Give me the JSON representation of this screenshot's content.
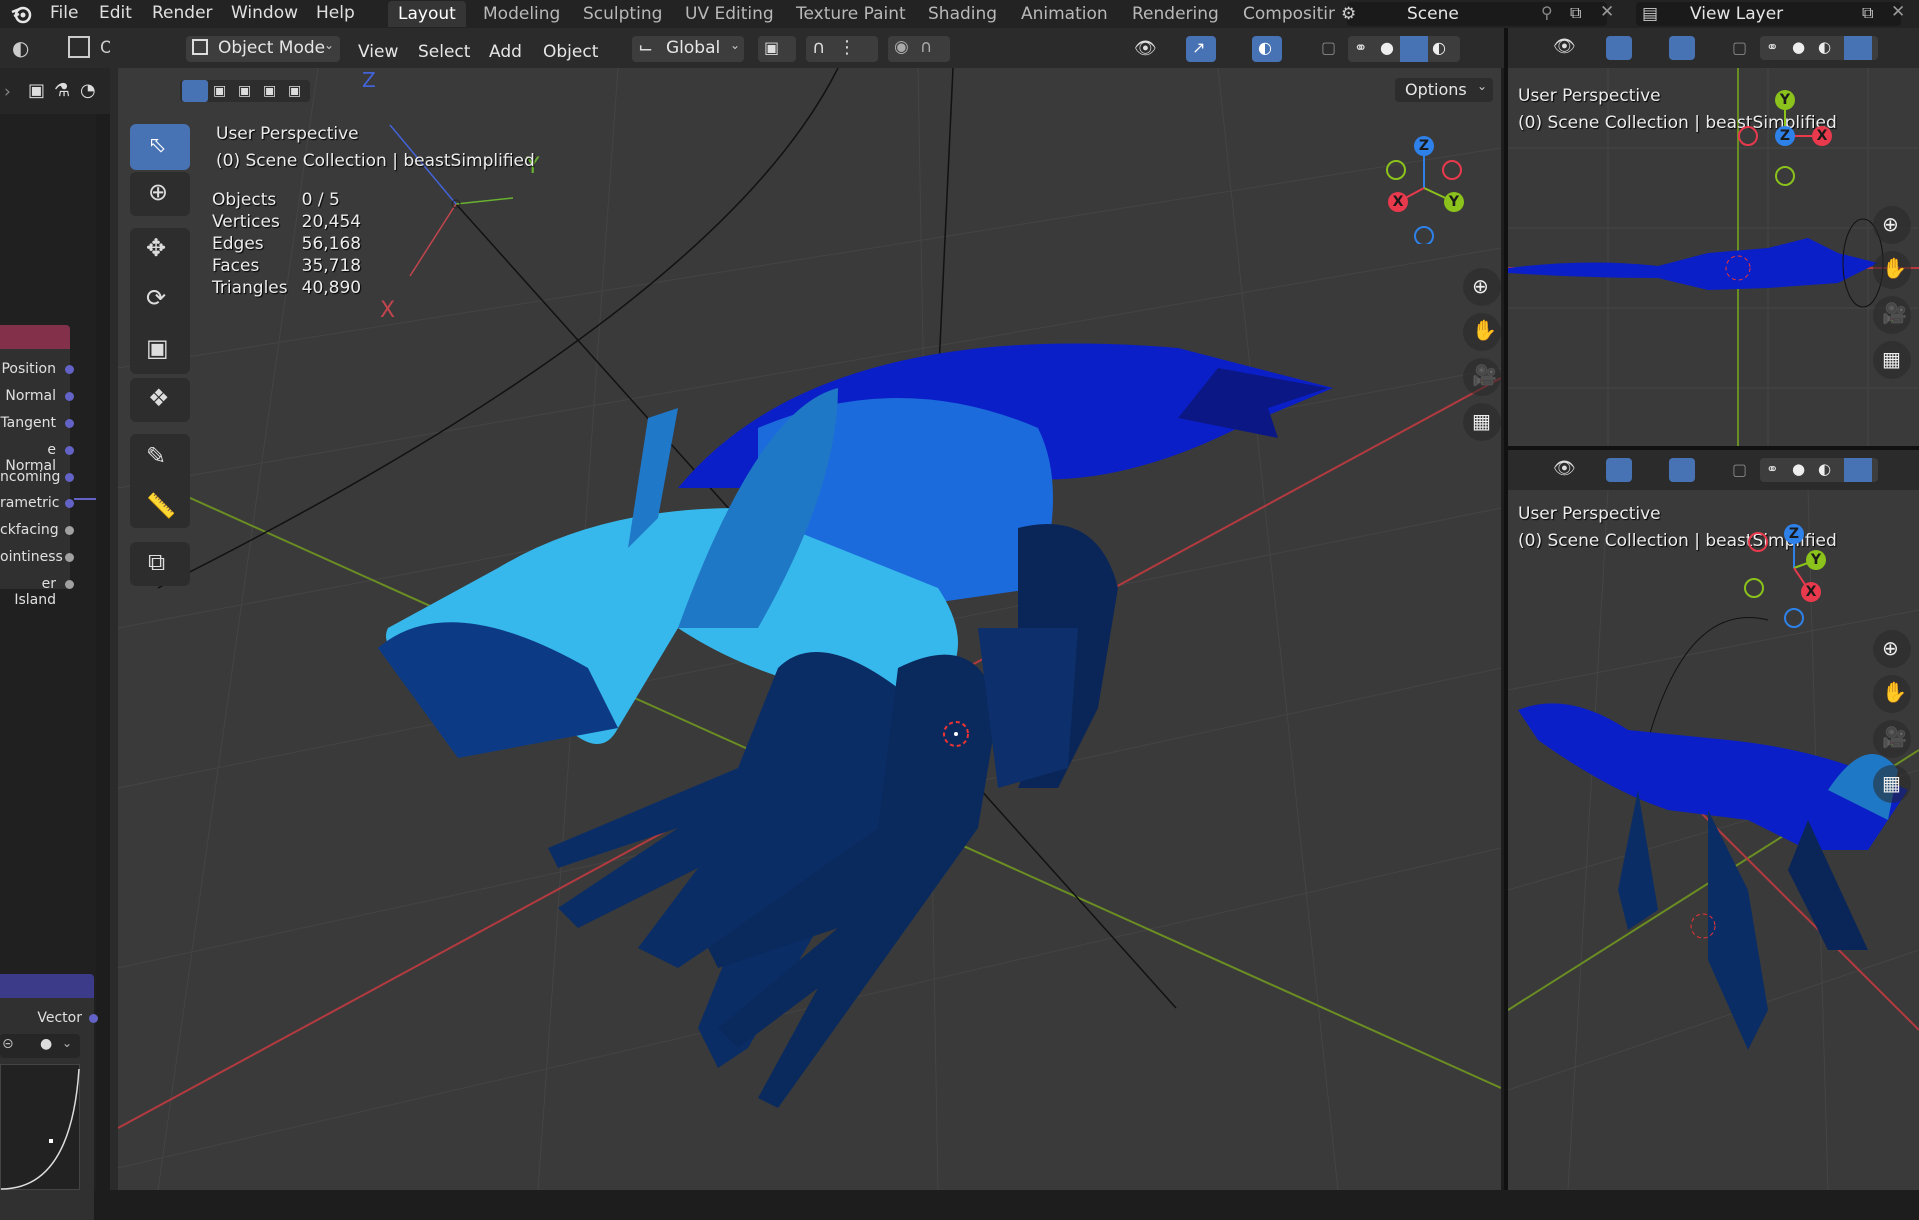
{
  "menubar": {
    "items": [
      "File",
      "Edit",
      "Render",
      "Window",
      "Help"
    ],
    "workspaces": [
      "Layout",
      "Modeling",
      "Sculpting",
      "UV Editing",
      "Texture Paint",
      "Shading",
      "Animation",
      "Rendering",
      "Compositing"
    ],
    "scene": "Scene",
    "view_layer": "View Layer"
  },
  "header": {
    "mode": "Object Mode",
    "menus": [
      "View",
      "Select",
      "Add",
      "Object"
    ],
    "orientation": "Global",
    "options": "Options",
    "object_mode_short": "O"
  },
  "main_viewport": {
    "view_name": "User Perspective",
    "collection": "(0) Scene Collection | beastSimplified",
    "stats": [
      {
        "label": "Objects",
        "value": "0 / 5"
      },
      {
        "label": "Vertices",
        "value": "20,454"
      },
      {
        "label": "Edges",
        "value": "56,168"
      },
      {
        "label": "Faces",
        "value": "35,718"
      },
      {
        "label": "Triangles",
        "value": "40,890"
      }
    ],
    "gizmo": {
      "x": "X",
      "y": "Y",
      "z": "Z"
    },
    "empty_axes": {
      "y": "Y",
      "x": "X",
      "z": "Z"
    }
  },
  "viewport_top_right": {
    "view_name": "User Perspective",
    "collection": "(0) Scene Collection | beastSimplified",
    "gizmo": {
      "x": "X",
      "y": "Y",
      "z": "Z"
    }
  },
  "viewport_bottom_right": {
    "view_name": "User Perspective",
    "collection": "(0) Scene Collection | beastSimplified",
    "gizmo": {
      "x": "X",
      "y": "Y",
      "z": "Z"
    }
  },
  "node_panel": {
    "sockets": [
      "Position",
      "Normal",
      "Tangent",
      "e Normal",
      "ncoming",
      "rametric",
      "ckfacing",
      "ointiness",
      "er Island"
    ],
    "vector_label": "Vector"
  },
  "colors": {
    "accent": "#4772b3",
    "axis_x": "#e8394d",
    "axis_y": "#8bc21b",
    "axis_z": "#2f81ea",
    "socket_blue": "#6363c7",
    "socket_gray": "#a1a1a1",
    "node_header_red": "#83314a",
    "node_header_blue": "#3b3b8a"
  },
  "icons": [
    "blender-logo-icon",
    "select-box-icon",
    "cursor-icon",
    "move-icon",
    "rotate-icon",
    "scale-icon",
    "transform-icon",
    "annotate-icon",
    "measure-icon",
    "add-cube-icon",
    "zoom-icon",
    "hand-icon",
    "camera-icon",
    "grid-icon",
    "pin-icon",
    "copy-icon",
    "close-icon"
  ]
}
